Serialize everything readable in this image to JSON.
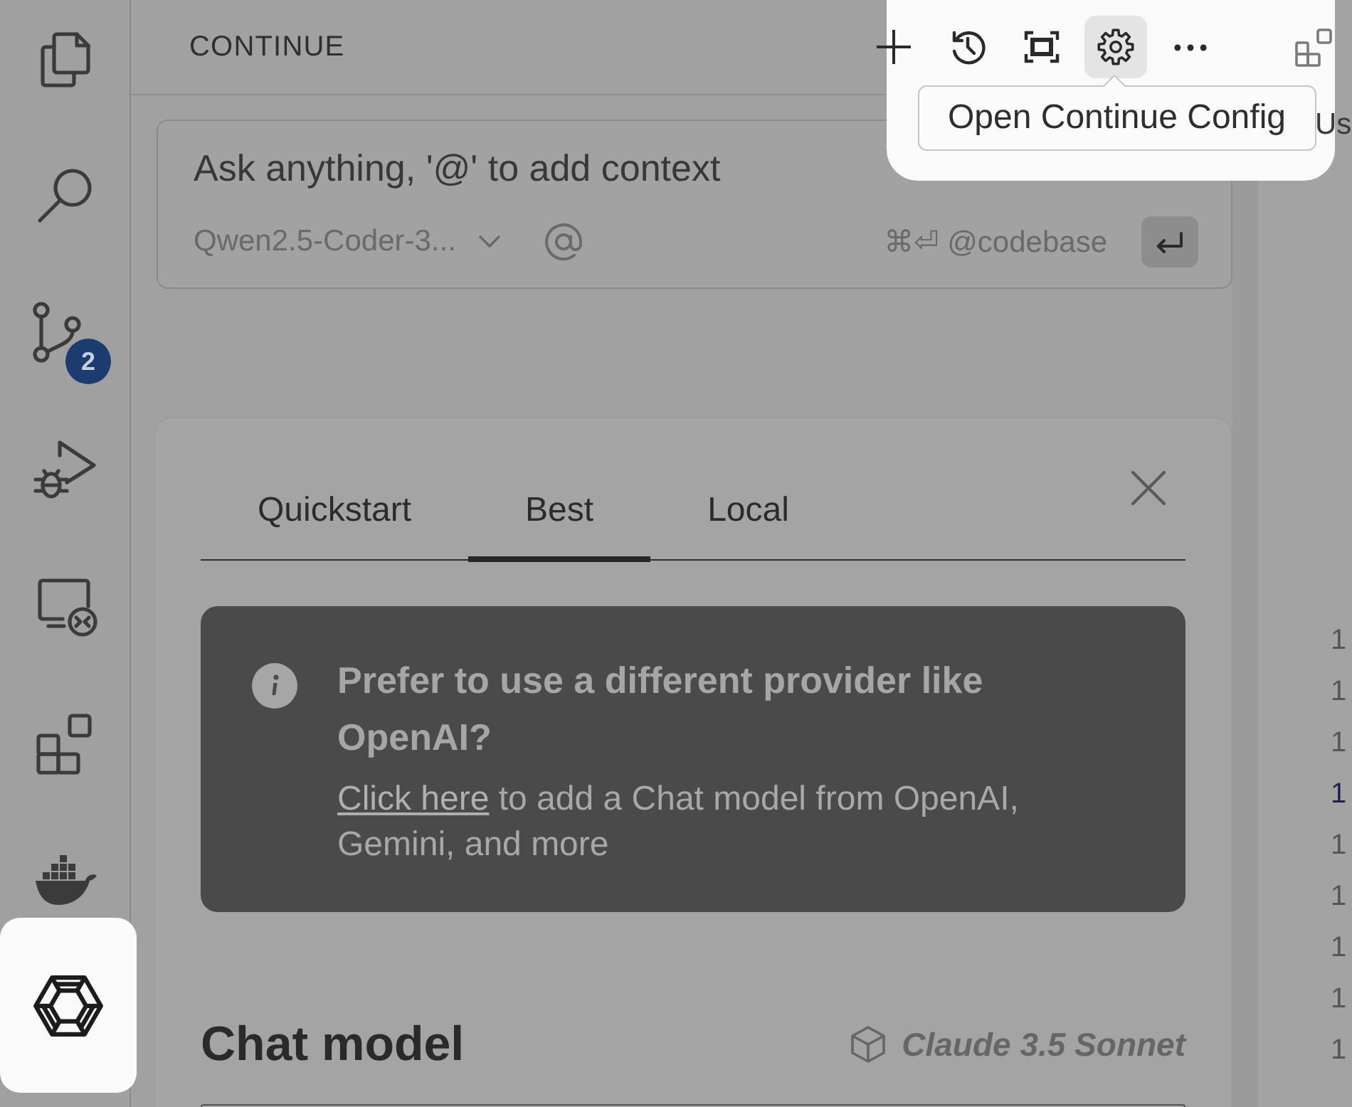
{
  "activity_bar": {
    "source_control_badge": "2",
    "continue_highlighted": true
  },
  "sidebar": {
    "title": "CONTINUE",
    "toolbar_highlighted": true,
    "toolbar": [
      {
        "hovered": false
      },
      {
        "hovered": false
      },
      {
        "hovered": false
      },
      {
        "hovered": true
      },
      {
        "hovered": false
      }
    ],
    "tooltip": "Open Continue Config"
  },
  "chat_input": {
    "placeholder": "Ask anything, '@' to add context",
    "model": "Qwen2.5-Coder-3...",
    "shortcut_hint": "⌘⏎ @codebase"
  },
  "onboarding": {
    "tabs": [
      {
        "label": "Quickstart",
        "selected": false
      },
      {
        "label": "Best",
        "selected": true
      },
      {
        "label": "Local",
        "selected": false
      }
    ],
    "notice": {
      "title": "Prefer to use a different provider like OpenAI?",
      "link": "Click here",
      "text": "to add a Chat model from OpenAI, Gemini, and more"
    },
    "chat_model": {
      "label": "Chat model",
      "value": "Claude 3.5 Sonnet"
    }
  },
  "editor": {
    "header_text": "Us",
    "line_numbers": [
      {
        "text": "1",
        "current": false
      },
      {
        "text": "1",
        "current": false
      },
      {
        "text": "1",
        "current": false
      },
      {
        "text": "1",
        "current": true
      },
      {
        "text": "1",
        "current": false
      },
      {
        "text": "1",
        "current": false
      },
      {
        "text": "1",
        "current": false
      },
      {
        "text": "1",
        "current": false
      },
      {
        "text": "1",
        "current": false
      }
    ]
  }
}
